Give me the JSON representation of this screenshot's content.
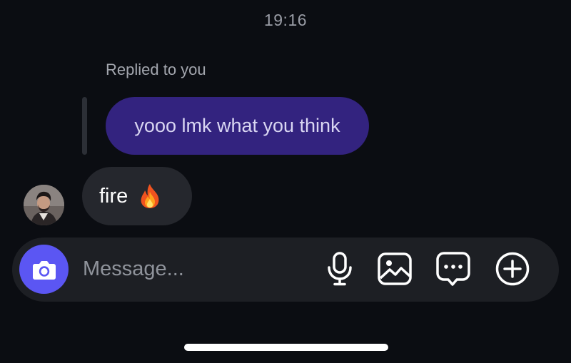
{
  "thread": {
    "timestamp": "19:16",
    "reply_caption": "Replied to you",
    "replied_message": "yooo lmk what you think",
    "incoming_message": "fire",
    "incoming_emoji": "fire-emoji"
  },
  "composer": {
    "placeholder": "Message...",
    "value": "",
    "camera_icon": "camera-icon",
    "buttons": [
      "microphone-icon",
      "gallery-icon",
      "sticker-chat-icon",
      "plus-circle-icon"
    ]
  },
  "colors": {
    "background": "#0b0d12",
    "outgoing_bubble": "#33237f",
    "incoming_bubble": "#25272d",
    "composer_bar": "#1d1f24",
    "camera_accent": "#5b56f3"
  }
}
